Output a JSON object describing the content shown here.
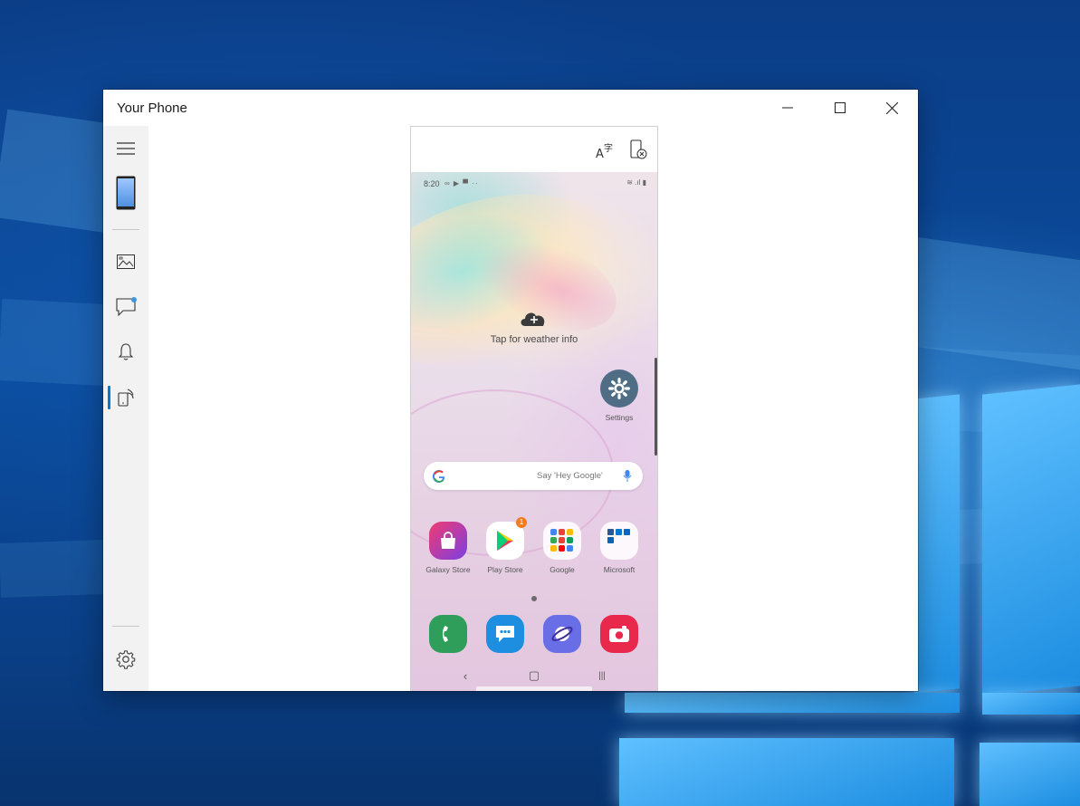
{
  "window": {
    "title": "Your Phone",
    "controls": {
      "minimize": "minimize",
      "maximize": "maximize",
      "close": "close"
    }
  },
  "sidebar": {
    "items": [
      {
        "name": "menu",
        "icon": "hamburger-icon"
      },
      {
        "name": "phone",
        "icon": "phone-icon"
      },
      {
        "name": "photos",
        "icon": "photos-icon"
      },
      {
        "name": "messages",
        "icon": "messages-icon",
        "has_badge": true
      },
      {
        "name": "notifications",
        "icon": "bell-icon"
      },
      {
        "name": "phone-screen",
        "icon": "phone-screen-icon",
        "active": true
      },
      {
        "name": "settings",
        "icon": "gear-icon"
      }
    ],
    "accent": "#0078d7"
  },
  "phone_toolbar": {
    "buttons": [
      {
        "name": "translate",
        "icon": "translate-icon"
      },
      {
        "name": "disconnect",
        "icon": "phone-disconnect-icon"
      }
    ]
  },
  "phone": {
    "status_time": "8:20",
    "weather": {
      "label": "Tap for weather info",
      "icon": "cloud-plus-icon"
    },
    "settings_app": {
      "label": "Settings",
      "icon": "gear-icon"
    },
    "search": {
      "placeholder": "Say 'Hey Google'",
      "icon": "google-g-icon",
      "mic": "mic-icon"
    },
    "apps": [
      {
        "label": "Galaxy Store",
        "icon": "galaxy-store-icon",
        "badge": ""
      },
      {
        "label": "Play Store",
        "icon": "play-store-icon",
        "badge": "1"
      },
      {
        "label": "Google",
        "icon": "google-folder-icon",
        "badge": ""
      },
      {
        "label": "Microsoft",
        "icon": "microsoft-folder-icon",
        "badge": ""
      }
    ],
    "dock": [
      {
        "label": "Phone",
        "icon": "dialer-icon",
        "color": "#2e9e5a"
      },
      {
        "label": "Messages",
        "icon": "messages-icon",
        "color": "#1e8fe0"
      },
      {
        "label": "Internet",
        "icon": "internet-icon",
        "color": "#6a6ee6"
      },
      {
        "label": "Camera",
        "icon": "camera-icon",
        "color": "#e8294c"
      }
    ],
    "nav": {
      "back": "‹",
      "home": "▢",
      "recents": "|||"
    }
  },
  "colors": {
    "desktop_blue": "#0a4c9e",
    "window_bg": "#ffffff",
    "sidebar_bg": "#f2f2f2",
    "badge_orange": "#f47b20"
  }
}
